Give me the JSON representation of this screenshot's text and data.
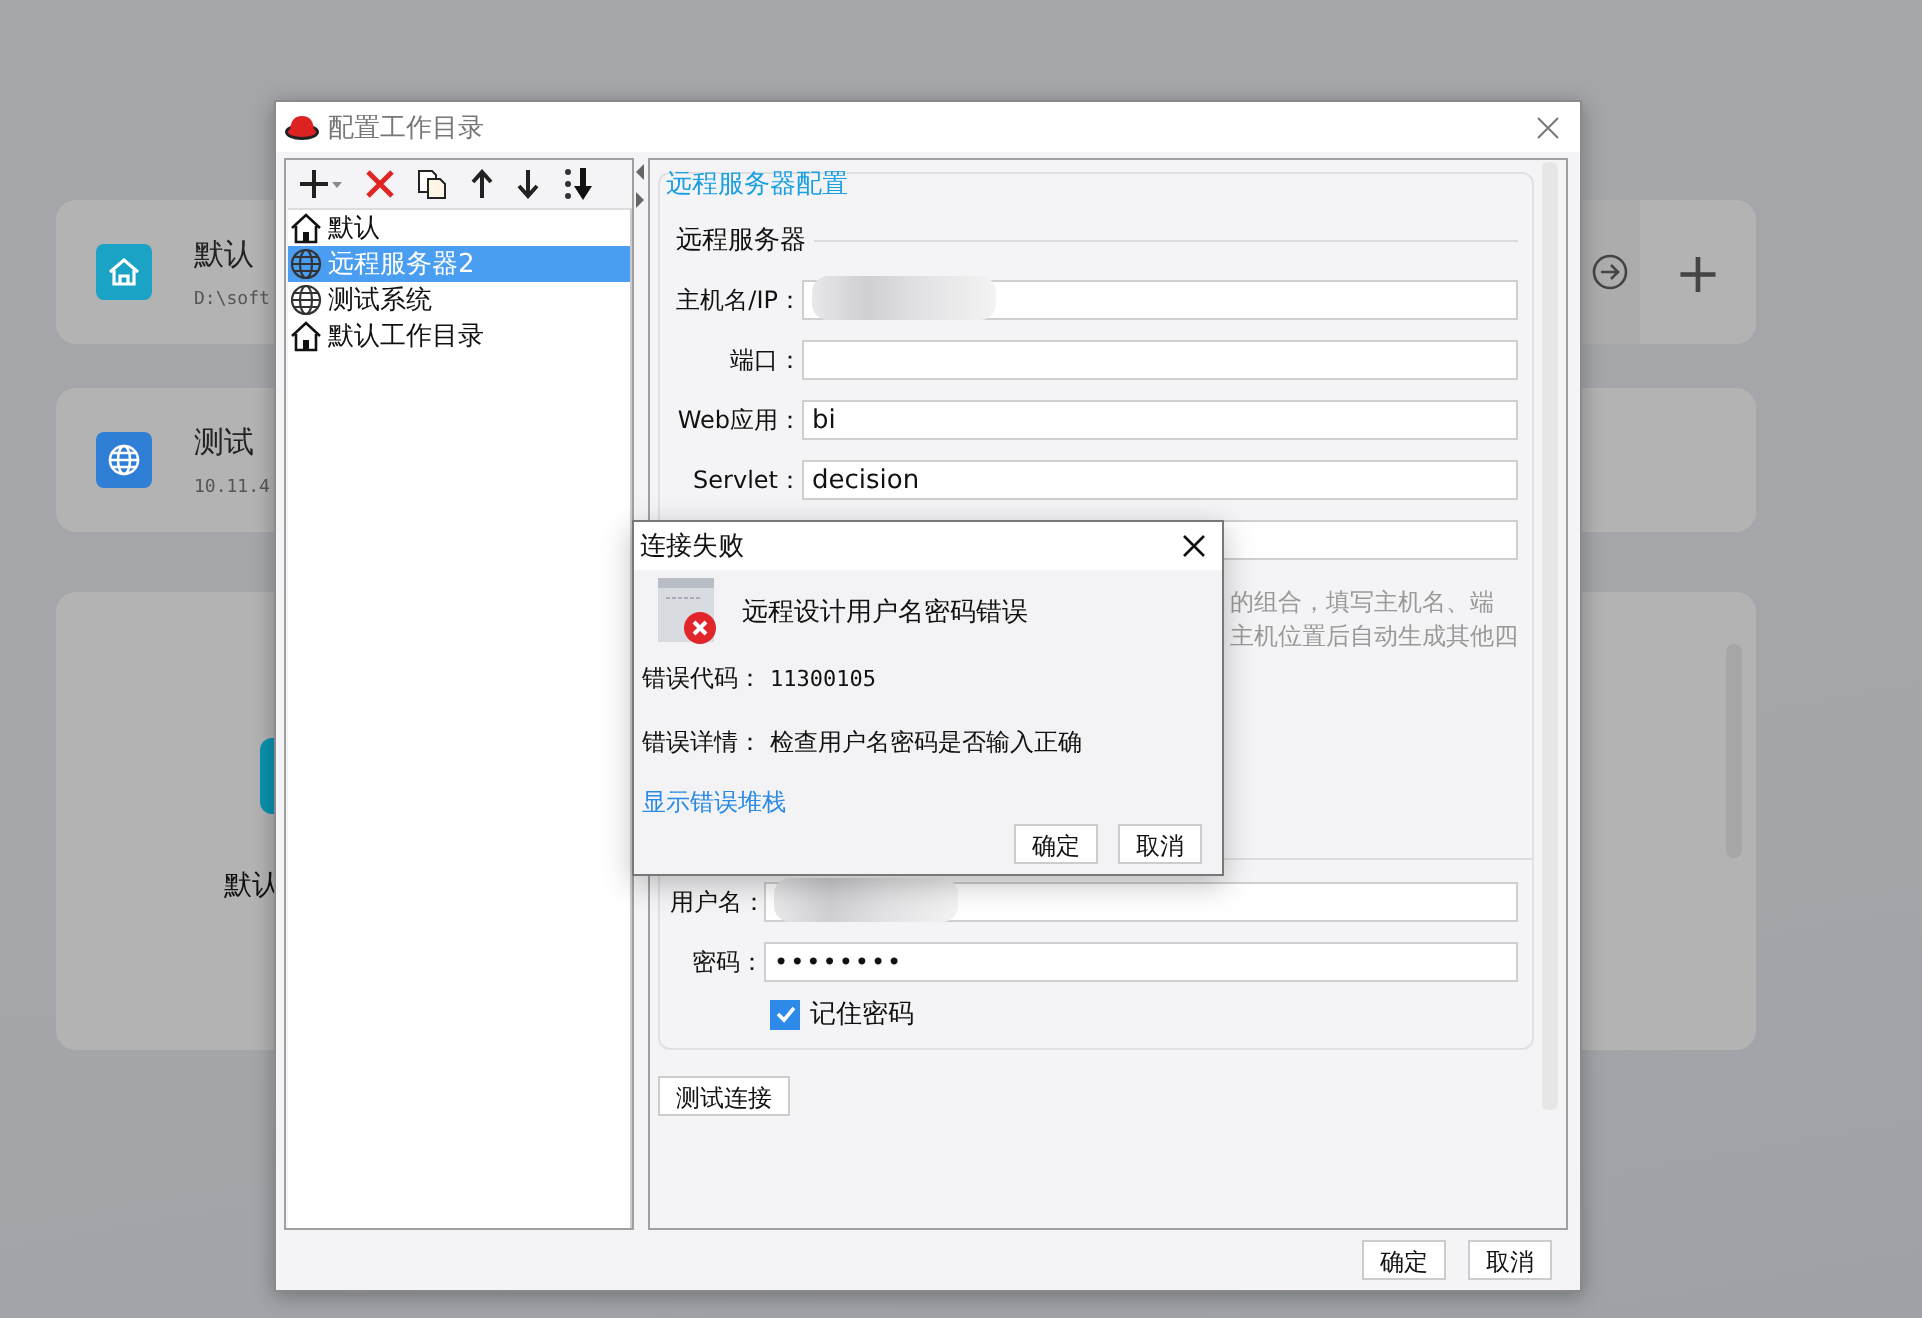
{
  "background": {
    "cards": [
      {
        "kind": "home",
        "name": "默认",
        "path": "D:\\soft"
      },
      {
        "kind": "globe",
        "name": "测试",
        "path": "10.11.4"
      }
    ],
    "panel": {
      "label": "默认"
    },
    "add_button": "+"
  },
  "dialog": {
    "title": "配置工作目录",
    "tree": [
      {
        "kind": "home",
        "label": "默认",
        "selected": false
      },
      {
        "kind": "globe",
        "label": "远程服务器2",
        "selected": true
      },
      {
        "kind": "globe",
        "label": "测试系统",
        "selected": false
      },
      {
        "kind": "home",
        "label": "默认工作目录",
        "selected": false
      }
    ],
    "section_title": "远程服务器配置",
    "subsection": "远程服务器",
    "fields": [
      {
        "kind": "text",
        "label": "主机名/IP：",
        "blurred": true
      },
      {
        "kind": "text",
        "label": "端口："
      },
      {
        "kind": "text",
        "label": "Web应用：",
        "value": "bi"
      },
      {
        "kind": "text",
        "label": "Servlet：",
        "value": "decision"
      },
      {
        "kind": "text"
      }
    ],
    "help_lines": [
      "的组合，填写主机名、端",
      "主机位置后自动生成其他四"
    ],
    "username": {
      "label": "用户名：",
      "blurred": true
    },
    "password": {
      "label": "密码：",
      "value": "••••••••"
    },
    "remember": {
      "label": "记住密码",
      "checked": true
    },
    "test_button": "测试连接",
    "buttons": [
      "确定",
      "取消"
    ]
  },
  "error": {
    "title": "连接失败",
    "message": "远程设计用户名密码错误",
    "code_label": "错误代码：",
    "code": "11300105",
    "detail_label": "错误详情：",
    "detail": "检查用户名密码是否输入正确",
    "link": "显示错误堆栈",
    "buttons": [
      "确定",
      "取消"
    ]
  }
}
